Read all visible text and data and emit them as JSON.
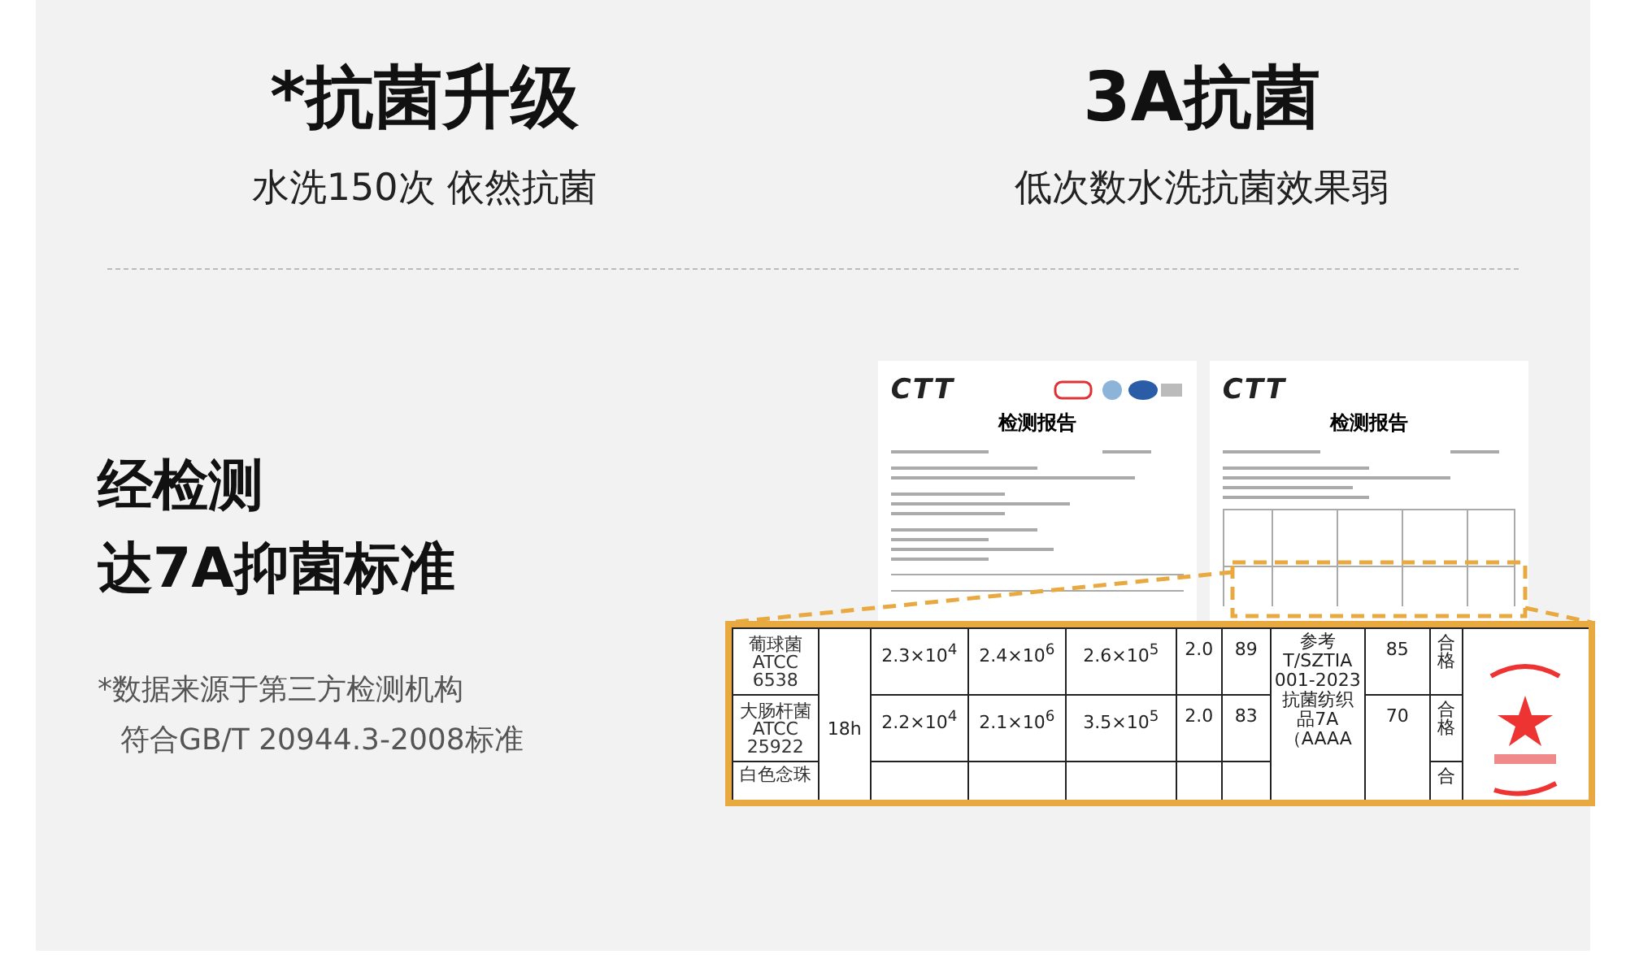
{
  "columns": [
    {
      "title": "*抗菌升级",
      "subtitle": "水洗150次 依然抗菌"
    },
    {
      "title": "3A抗菌",
      "subtitle": "低次数水洗抗菌效果弱"
    }
  ],
  "claim": {
    "heading_lines": [
      "经检测",
      "达7A抑菌标准"
    ],
    "note_lines": [
      "*数据来源于第三方检测机构",
      "符合GB/T 20944.3-2008标准"
    ]
  },
  "reports": [
    {
      "logo": "CTT",
      "title": "检测报告"
    },
    {
      "logo": "CTT",
      "title": "检测报告"
    }
  ],
  "zoom_table": {
    "duration": "18h",
    "standard": "参考 T/SZTIA 001-2023抗菌纺织品7A（AAAA",
    "rows": [
      {
        "strain": "葡球菌 ATCC 6538",
        "c1": "2.3×10$^{4}$",
        "c2": "2.4×10$^{6}$",
        "c3": "2.6×10$^{5}$",
        "factor": "2.0",
        "rate": "89",
        "value": "85",
        "result": "合格"
      },
      {
        "strain": "大肠杆菌 ATCC 25922",
        "c1": "2.2×10$^{4}$",
        "c2": "2.1×10$^{6}$",
        "c3": "3.5×10$^{5}$",
        "factor": "2.0",
        "rate": "83",
        "value": "70",
        "result": "合格"
      },
      {
        "strain": "白色念珠",
        "c1": "",
        "c2": "",
        "c3": "",
        "factor": "",
        "rate": "",
        "result": "合"
      }
    ]
  }
}
